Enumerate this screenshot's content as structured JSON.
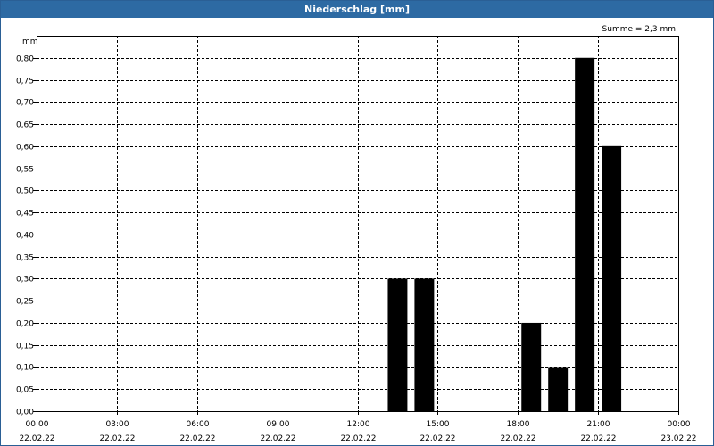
{
  "window": {
    "title": "Niederschlag [mm]"
  },
  "chart_data": {
    "type": "bar",
    "title": "Niederschlag [mm]",
    "unit": "mm",
    "summary": "Summe = 2,3 mm",
    "ylim": [
      0,
      0.85
    ],
    "y_ticks": [
      "0,00",
      "0,05",
      "0,10",
      "0,15",
      "0,20",
      "0,25",
      "0,30",
      "0,35",
      "0,40",
      "0,45",
      "0,50",
      "0,55",
      "0,60",
      "0,65",
      "0,70",
      "0,75",
      "0,80"
    ],
    "x_ticks": [
      {
        "time": "00:00",
        "date": "22.02.22"
      },
      {
        "time": "03:00",
        "date": "22.02.22"
      },
      {
        "time": "06:00",
        "date": "22.02.22"
      },
      {
        "time": "09:00",
        "date": "22.02.22"
      },
      {
        "time": "12:00",
        "date": "22.02.22"
      },
      {
        "time": "15:00",
        "date": "22.02.22"
      },
      {
        "time": "18:00",
        "date": "22.02.22"
      },
      {
        "time": "21:00",
        "date": "22.02.22"
      },
      {
        "time": "00:00",
        "date": "23.02.22"
      }
    ],
    "x_range": [
      "22.02.22 00:00",
      "23.02.22 00:00"
    ],
    "bar_interval_hours": 1,
    "bars": [
      {
        "start": "22.02.22 13:00",
        "end": "22.02.22 14:00",
        "value": 0.3
      },
      {
        "start": "22.02.22 14:00",
        "end": "22.02.22 15:00",
        "value": 0.3
      },
      {
        "start": "22.02.22 18:00",
        "end": "22.02.22 19:00",
        "value": 0.2
      },
      {
        "start": "22.02.22 19:00",
        "end": "22.02.22 20:00",
        "value": 0.1
      },
      {
        "start": "22.02.22 20:00",
        "end": "22.02.22 21:00",
        "value": 0.8
      },
      {
        "start": "22.02.22 21:00",
        "end": "22.02.22 22:00",
        "value": 0.6
      }
    ],
    "grid": true,
    "bar_color": "#000000",
    "grid_color": "#000000"
  }
}
